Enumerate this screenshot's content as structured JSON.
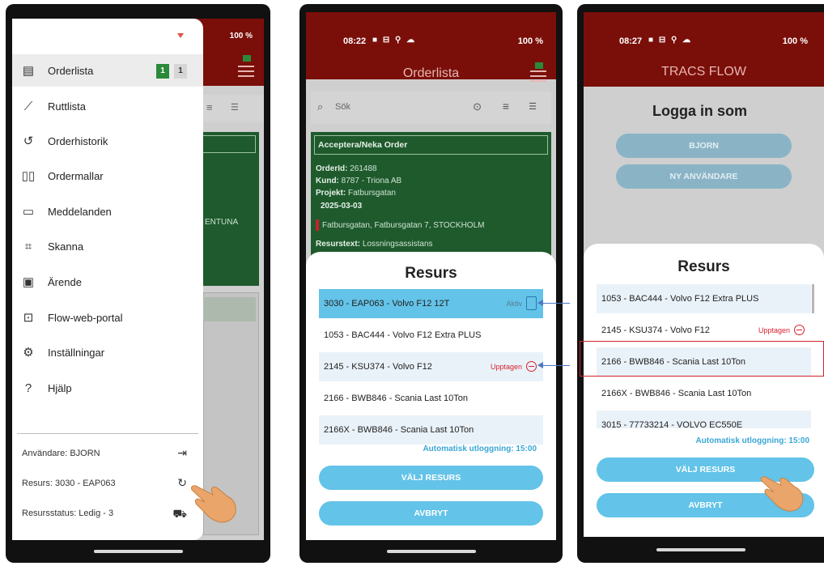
{
  "status_bar": {
    "time_a": "08:22",
    "time_b": "08:27",
    "battery": "100 %"
  },
  "phone1": {
    "menu_items": [
      {
        "label": "Orderlista",
        "icon": "list-icon",
        "badge_green": "1",
        "badge_gray": "1"
      },
      {
        "label": "Ruttlista",
        "icon": "route-icon"
      },
      {
        "label": "Orderhistorik",
        "icon": "history-icon"
      },
      {
        "label": "Ordermallar",
        "icon": "book-icon"
      },
      {
        "label": "Meddelanden",
        "icon": "message-icon"
      },
      {
        "label": "Skanna",
        "icon": "scan-icon"
      },
      {
        "label": "Ärende",
        "icon": "ticket-icon"
      },
      {
        "label": "Flow-web-portal",
        "icon": "portal-icon"
      },
      {
        "label": "Inställningar",
        "icon": "gear-icon"
      },
      {
        "label": "Hjälp",
        "icon": "help-icon"
      }
    ],
    "footer": {
      "user": "Användare: BJORN",
      "resource": "Resurs: 3030 - EAP063",
      "resource_status": "Resursstatus: Ledig - 3"
    },
    "bg_fragment": "ENTUNA"
  },
  "phone2": {
    "title": "Orderlista",
    "search_placeholder": "Sök",
    "card": {
      "header": "Acceptera/Neka Order",
      "order_label": "OrderId:",
      "order_value": "261488",
      "customer_label": "Kund:",
      "customer_value": "8787 - Triona AB",
      "project_label": "Projekt:",
      "project_value": "Fatbursgatan",
      "date": "2025-03-03",
      "address": "Fatbursgatan, Fatbursgatan 7, STOCKHOLM",
      "resource_text_label": "Resurstext:",
      "resource_text_value": "Lossningsassistans"
    },
    "sheet": {
      "title": "Resurs",
      "rows": [
        {
          "label": "3030 - EAP063 - Volvo F12 12T",
          "status": "Aktiv"
        },
        {
          "label": "1053 - BAC444 - Volvo F12 Extra PLUS",
          "status": ""
        },
        {
          "label": "2145 - KSU374 - Volvo F12",
          "status": "Upptagen"
        },
        {
          "label": "2166 - BWB846 - Scania Last 10Ton",
          "status": ""
        },
        {
          "label": "2166X - BWB846 - Scania Last 10Ton",
          "status": ""
        }
      ],
      "auto_logout": "Automatisk utloggning: 15:00",
      "select_button": "VÄLJ RESURS",
      "cancel_button": "AVBRYT"
    }
  },
  "phone3": {
    "title": "TRACS FLOW",
    "login_heading": "Logga in som",
    "user_button": "BJORN",
    "new_user_button": "NY ANVÄNDARE",
    "sheet": {
      "title": "Resurs",
      "rows": [
        {
          "label": "1053 - BAC444 - Volvo F12 Extra PLUS",
          "status": ""
        },
        {
          "label": "2145 - KSU374 - Volvo F12",
          "status": "Upptagen"
        },
        {
          "label": "2166 - BWB846 - Scania Last 10Ton",
          "status": ""
        },
        {
          "label": "2166X - BWB846 - Scania Last 10Ton",
          "status": ""
        },
        {
          "label": "3015 - 77733214 - VOLVO EC550E",
          "status": ""
        }
      ],
      "auto_logout": "Automatisk utloggning: 15:00",
      "select_button": "VÄLJ RESURS",
      "cancel_button": "AVBRYT"
    }
  },
  "colors": {
    "appbar": "#7a0f0a",
    "accent": "#63c3e8",
    "busy": "#d9202f",
    "order_card": "#1f5a2d"
  }
}
